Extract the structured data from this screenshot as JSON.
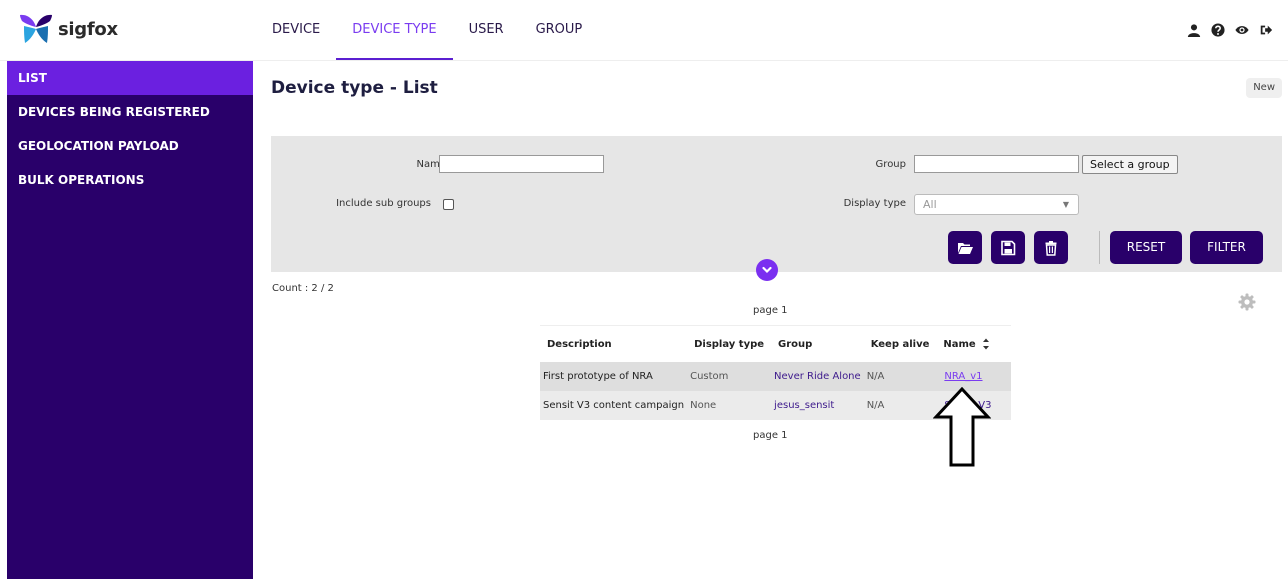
{
  "brand": {
    "name": "sigfox"
  },
  "nav": [
    {
      "label": "DEVICE",
      "active": false
    },
    {
      "label": "DEVICE TYPE",
      "active": true
    },
    {
      "label": "USER",
      "active": false
    },
    {
      "label": "GROUP",
      "active": false
    }
  ],
  "top_icons": [
    "user-icon",
    "help-icon",
    "eye-icon",
    "logout-icon"
  ],
  "sidebar": {
    "items": [
      {
        "label": "LIST",
        "active": true
      },
      {
        "label": "DEVICES BEING REGISTERED",
        "active": false
      },
      {
        "label": "GEOLOCATION PAYLOAD",
        "active": false
      },
      {
        "label": "BULK OPERATIONS",
        "active": false
      }
    ]
  },
  "page": {
    "title": "Device type - List",
    "new_label": "New"
  },
  "filter": {
    "name_label": "Name",
    "name_value": "",
    "group_label": "Group",
    "group_value": "",
    "select_group_label": "Select a group",
    "include_sub_label": "Include sub groups",
    "include_sub_checked": false,
    "display_type_label": "Display type",
    "display_type_value": "All",
    "reset_label": "RESET",
    "filter_label": "FILTER"
  },
  "results": {
    "count_text": "Count : 2 / 2",
    "page_top": "page 1",
    "page_bottom": "page 1",
    "columns": [
      "Description",
      "Display type",
      "Group",
      "Keep alive",
      "Name"
    ],
    "rows": [
      {
        "description": "First prototype of NRA",
        "display_type": "Custom",
        "group": "Never Ride Alone",
        "keep_alive": "N/A",
        "name": "NRA_v1"
      },
      {
        "description": "Sensit V3 content campaign",
        "display_type": "None",
        "group": "jesus_sensit",
        "keep_alive": "N/A",
        "name": "Sensit V3"
      }
    ]
  },
  "colors": {
    "sidebar_bg": "#29006a",
    "sidebar_active": "#6b20e0",
    "accent": "#7a3cf0",
    "button_bg": "#29006a"
  }
}
